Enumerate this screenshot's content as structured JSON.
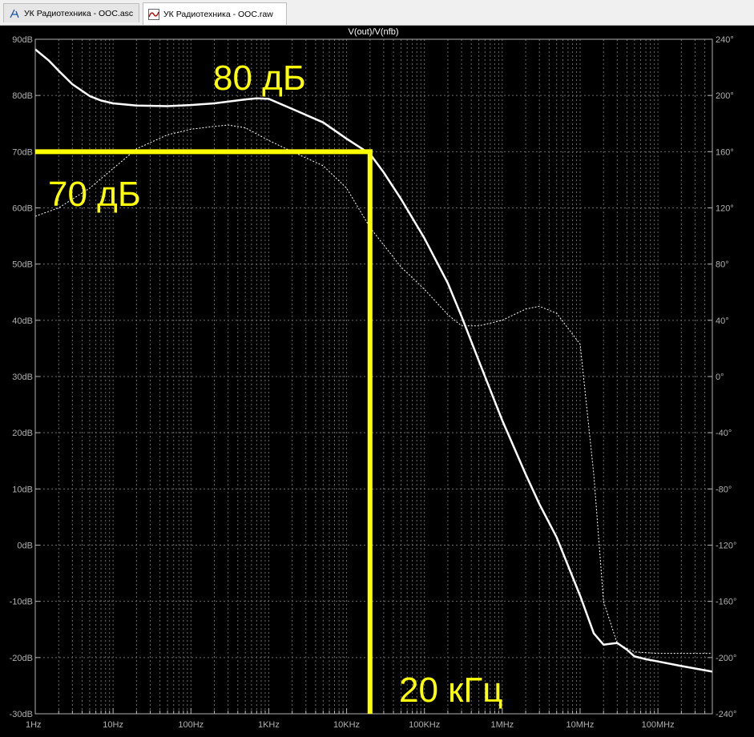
{
  "tabs": [
    {
      "label": "УК Радиотехника - ООС.asc",
      "icon": "schematic-icon",
      "active": false
    },
    {
      "label": "УК Радиотехника - ООС.raw",
      "icon": "waveform-icon",
      "active": true
    }
  ],
  "colors": {
    "background": "#000000",
    "axis": "#b0b0b0",
    "grid": "#6a6a6a",
    "trace": "#ffffff",
    "annotation": "#ffff00"
  },
  "chart_data": {
    "type": "line",
    "title": "V(out)/V(nfb)",
    "x_scale": "log",
    "xlim": [
      1,
      500000000
    ],
    "x_ticks": [
      {
        "value": 1,
        "label": "1Hz"
      },
      {
        "value": 10,
        "label": "10Hz"
      },
      {
        "value": 100,
        "label": "100Hz"
      },
      {
        "value": 1000,
        "label": "1KHz"
      },
      {
        "value": 10000,
        "label": "10KHz"
      },
      {
        "value": 100000,
        "label": "100KHz"
      },
      {
        "value": 1000000,
        "label": "1MHz"
      },
      {
        "value": 10000000,
        "label": "10MHz"
      },
      {
        "value": 100000000,
        "label": "100MHz"
      }
    ],
    "ylim": [
      -30,
      90
    ],
    "y_ticks": [
      {
        "value": 90,
        "label": "90dB"
      },
      {
        "value": 80,
        "label": "80dB"
      },
      {
        "value": 70,
        "label": "70dB"
      },
      {
        "value": 60,
        "label": "60dB"
      },
      {
        "value": 50,
        "label": "50dB"
      },
      {
        "value": 40,
        "label": "40dB"
      },
      {
        "value": 30,
        "label": "30dB"
      },
      {
        "value": 20,
        "label": "20dB"
      },
      {
        "value": 10,
        "label": "10dB"
      },
      {
        "value": 0,
        "label": "0dB"
      },
      {
        "value": -10,
        "label": "-10dB"
      },
      {
        "value": -20,
        "label": "-20dB"
      },
      {
        "value": -30,
        "label": "-30dB"
      }
    ],
    "y2lim": [
      -240,
      240
    ],
    "y2_ticks": [
      {
        "value": 240,
        "label": "240°"
      },
      {
        "value": 200,
        "label": "200°"
      },
      {
        "value": 160,
        "label": "160°"
      },
      {
        "value": 120,
        "label": "120°"
      },
      {
        "value": 80,
        "label": "80°"
      },
      {
        "value": 40,
        "label": "40°"
      },
      {
        "value": 0,
        "label": "0°"
      },
      {
        "value": -40,
        "label": "-40°"
      },
      {
        "value": -80,
        "label": "-80°"
      },
      {
        "value": -120,
        "label": "-120°"
      },
      {
        "value": -160,
        "label": "-160°"
      },
      {
        "value": -200,
        "label": "-200°"
      },
      {
        "value": -240,
        "label": "-240°"
      }
    ],
    "grid": true,
    "series": [
      {
        "axis": "left",
        "style": "solid",
        "x": [
          1,
          1.5,
          2,
          3,
          5,
          7,
          10,
          20,
          50,
          100,
          200,
          500,
          700,
          1000,
          2000,
          5000,
          10000,
          20000,
          30000,
          50000,
          100000,
          200000,
          300000,
          500000,
          1000000,
          2000000,
          3000000,
          5000000,
          10000000,
          15000000,
          20000000,
          30000000,
          40000000,
          50000000,
          70000000,
          100000000,
          200000000,
          500000000
        ],
        "y": [
          88.2,
          86.2,
          84.4,
          82.0,
          79.9,
          79.1,
          78.6,
          78.2,
          78.1,
          78.3,
          78.6,
          79.3,
          79.5,
          79.4,
          77.6,
          75.2,
          72.3,
          69.6,
          66.3,
          61.6,
          54.6,
          46.6,
          40.7,
          32.8,
          22.2,
          12.6,
          7.3,
          1.4,
          -9.0,
          -15.7,
          -17.7,
          -17.4,
          -18.6,
          -19.8,
          -20.3,
          -20.7,
          -21.5,
          -22.5
        ]
      },
      {
        "axis": "right",
        "style": "dashed",
        "x": [
          1,
          2,
          5,
          10,
          20,
          50,
          100,
          200,
          300,
          500,
          1000,
          2000,
          5000,
          10000,
          20000,
          50000,
          100000,
          200000,
          300000,
          500000,
          1000000,
          2000000,
          3000000,
          5000000,
          10000000,
          15000000,
          20000000,
          30000000,
          50000000,
          100000000,
          200000000,
          500000000
        ],
        "y": [
          114,
          120,
          134,
          148,
          162,
          172,
          176,
          178,
          179,
          177,
          168,
          160,
          150,
          134,
          106,
          78,
          62,
          44,
          36,
          36,
          40,
          48,
          50,
          45,
          23,
          -70,
          -160,
          -190,
          -196,
          -197,
          -197,
          -197
        ]
      }
    ],
    "annotations": [
      {
        "text": "80 дБ"
      },
      {
        "text": "70 дБ",
        "y": 70
      },
      {
        "text": "20 кГц",
        "x": 20000
      }
    ]
  }
}
